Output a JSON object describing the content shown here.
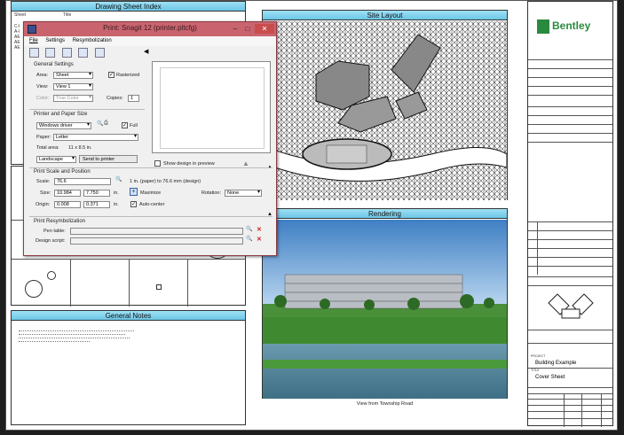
{
  "index": {
    "title": "Drawing Sheet Index",
    "col_sheet": "Sheet",
    "col_title": "Title",
    "rows": [
      "C-l",
      "A-l",
      "AE",
      "AE",
      "AE"
    ]
  },
  "site_layout": {
    "title": "Site Layout"
  },
  "rendering": {
    "title": "Rendering",
    "caption": "View from Township Road"
  },
  "general_notes": {
    "title": "General Notes"
  },
  "title_block": {
    "brand": "Bentley",
    "project_label": "PROJECT",
    "project": "Building Example",
    "sheet_label": "TITLE",
    "sheet": "Cover Sheet"
  },
  "dialog": {
    "title": "Print: Snagit 12 (printer.pltcfg)",
    "min_btn": "–",
    "max_btn": "□",
    "close_btn": "✕",
    "menu": [
      "File",
      "Settings",
      "Resymbolization"
    ],
    "general_settings": {
      "label": "General Settings",
      "area_label": "Area:",
      "area_value": "Sheet",
      "rasterized_label": "Rasterized",
      "view_label": "View:",
      "view_value": "View 1",
      "color_label": "Color:",
      "color_value": "True Color",
      "copies_label": "Copies:",
      "copies_value": "1"
    },
    "printer_paper": {
      "label": "Printer and Paper Size",
      "driver_value": "Windows driver",
      "full_label": "Full",
      "paper_label": "Paper:",
      "paper_value": "Letter",
      "total_area_label": "Total area:",
      "total_area_value": "11 x 8.5 in.",
      "orientation_value": "Landscape",
      "send_to_printer": "Send to printer",
      "show_design_label": "Show design in preview"
    },
    "scale_position": {
      "label": "Print Scale and Position",
      "scale_label": "Scale:",
      "scale_value": "76.6",
      "scale_text": "1 in. (paper) to 76.6 mm (design)",
      "size_label": "Size:",
      "size_w": "10.984",
      "size_h": "7.750",
      "size_unit": "in.",
      "maximize_label": "Maximize",
      "rotation_label": "Rotation:",
      "rotation_value": "None",
      "origin_label": "Origin:",
      "origin_x": "0.008",
      "origin_y": "0.371",
      "origin_unit": "in.",
      "auto_center_label": "Auto-center"
    },
    "resymbolization": {
      "label": "Print Resymbolization",
      "pen_table_label": "Pen table:",
      "design_script_label": "Design script:"
    }
  },
  "colors": {
    "title_bg": "#c9646f",
    "panel_title": "#6cc6e6"
  }
}
